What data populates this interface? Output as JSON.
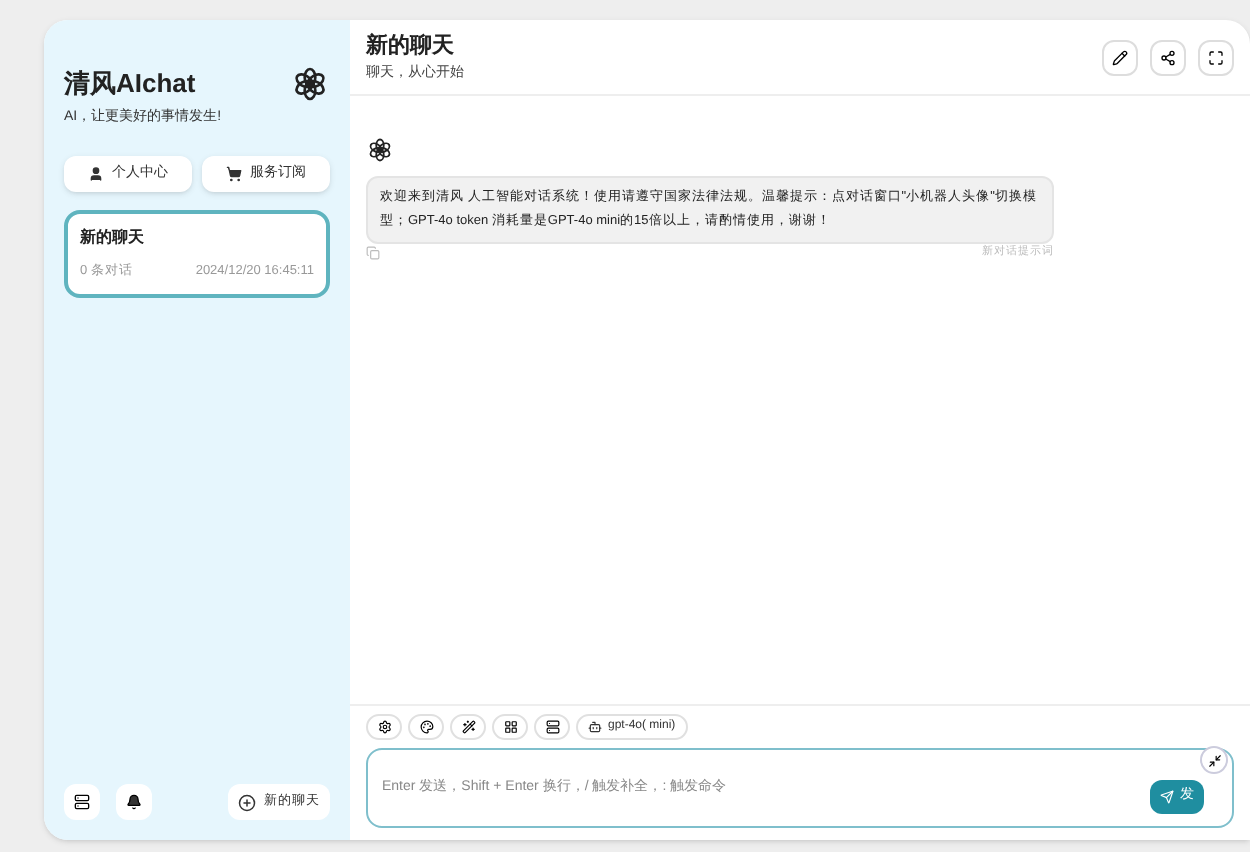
{
  "sidebar": {
    "title": "清风AIchat",
    "subtitle": "AI，让更美好的事情发生!",
    "buttons": [
      {
        "kind": "user",
        "label": "个人中心"
      },
      {
        "kind": "cart",
        "label": "服务订阅"
      }
    ],
    "chats": [
      {
        "title": "新的聊天",
        "count": "0 条对话",
        "time": "2024/12/20 16:45:11",
        "selected": true
      }
    ],
    "new_chat": "新的聊天"
  },
  "header": {
    "title": "新的聊天",
    "subtitle": "聊天，从心开始"
  },
  "messages": [
    {
      "text": "欢迎来到清风 人工智能对话系统！使用请遵守国家法律法规。温馨提示：点对话窗口\"小机器人头像\"切换模型；GPT-4o token 消耗量是GPT-4o mini的15倍以上，请酌情使用，谢谢！",
      "note": "新对话提示词"
    }
  ],
  "toolbar": {
    "model": "gpt-4o( mini)"
  },
  "input": {
    "placeholder": "Enter 发送，Shift + Enter 换行，/ 触发补全，: 触发命令",
    "send": "发"
  }
}
